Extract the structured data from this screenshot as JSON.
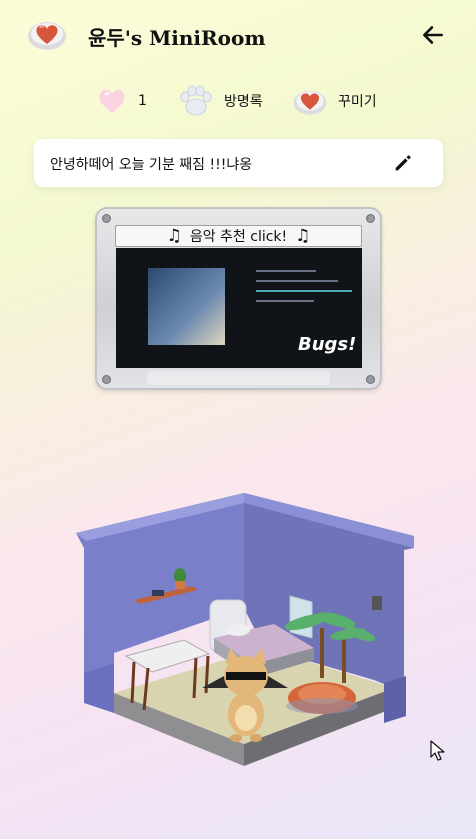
{
  "header": {
    "title": "윤두's MiniRoom",
    "logo_icon": "heart-cushion-icon",
    "back_icon": "arrow-left-icon"
  },
  "stats": {
    "likes": "1",
    "guestbook_label": "방명록",
    "decorate_label": "꾸미기",
    "like_icon": "heart-icon",
    "guestbook_icon": "paw-icon",
    "decorate_icon": "heart-cushion-icon"
  },
  "status": {
    "message": "안녕하떼어 오늘 기분 째짐 !!!냐옹",
    "edit_icon": "pencil-icon"
  },
  "music": {
    "label": "음악 추천 click!",
    "note_icon": "music-note-icon",
    "video_brand": "Bugs!"
  },
  "colors": {
    "room_wall": "#7a7fca",
    "room_floor": "#d9d4b0",
    "accent_heart": "#d8573c"
  }
}
